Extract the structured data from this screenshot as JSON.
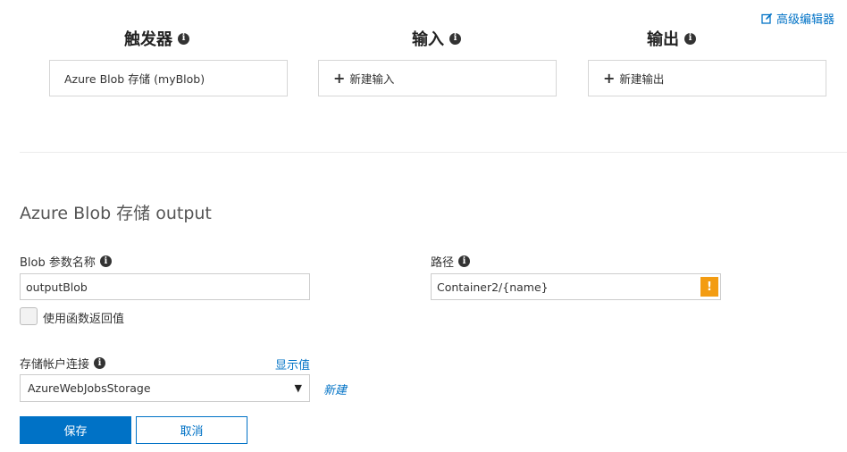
{
  "header": {
    "advanced_editor_label": "高级编辑器",
    "columns": [
      {
        "title": "触发器",
        "card_label": "Azure Blob 存储 (myBlob)",
        "card_icon": ""
      },
      {
        "title": "输入",
        "card_label": "新建输入",
        "card_icon": "plus-icon"
      },
      {
        "title": "输出",
        "card_label": "新建输出",
        "card_icon": "plus-icon"
      }
    ]
  },
  "form": {
    "section_title": "Azure Blob 存储 output",
    "blob_param": {
      "label": "Blob 参数名称",
      "value": "outputBlob"
    },
    "path": {
      "label": "路径",
      "value": "Container2/{name}",
      "warning_glyph": "!"
    },
    "use_return_value": {
      "label": "使用函数返回值",
      "checked": false
    },
    "storage_connection": {
      "label": "存储帐户连接",
      "show_value_link": "显示值",
      "selected": "AzureWebJobsStorage",
      "new_link": "新建"
    },
    "buttons": {
      "save": "保存",
      "cancel": "取消"
    }
  },
  "colors": {
    "accent": "#0072c6",
    "warning": "#f39c12"
  }
}
